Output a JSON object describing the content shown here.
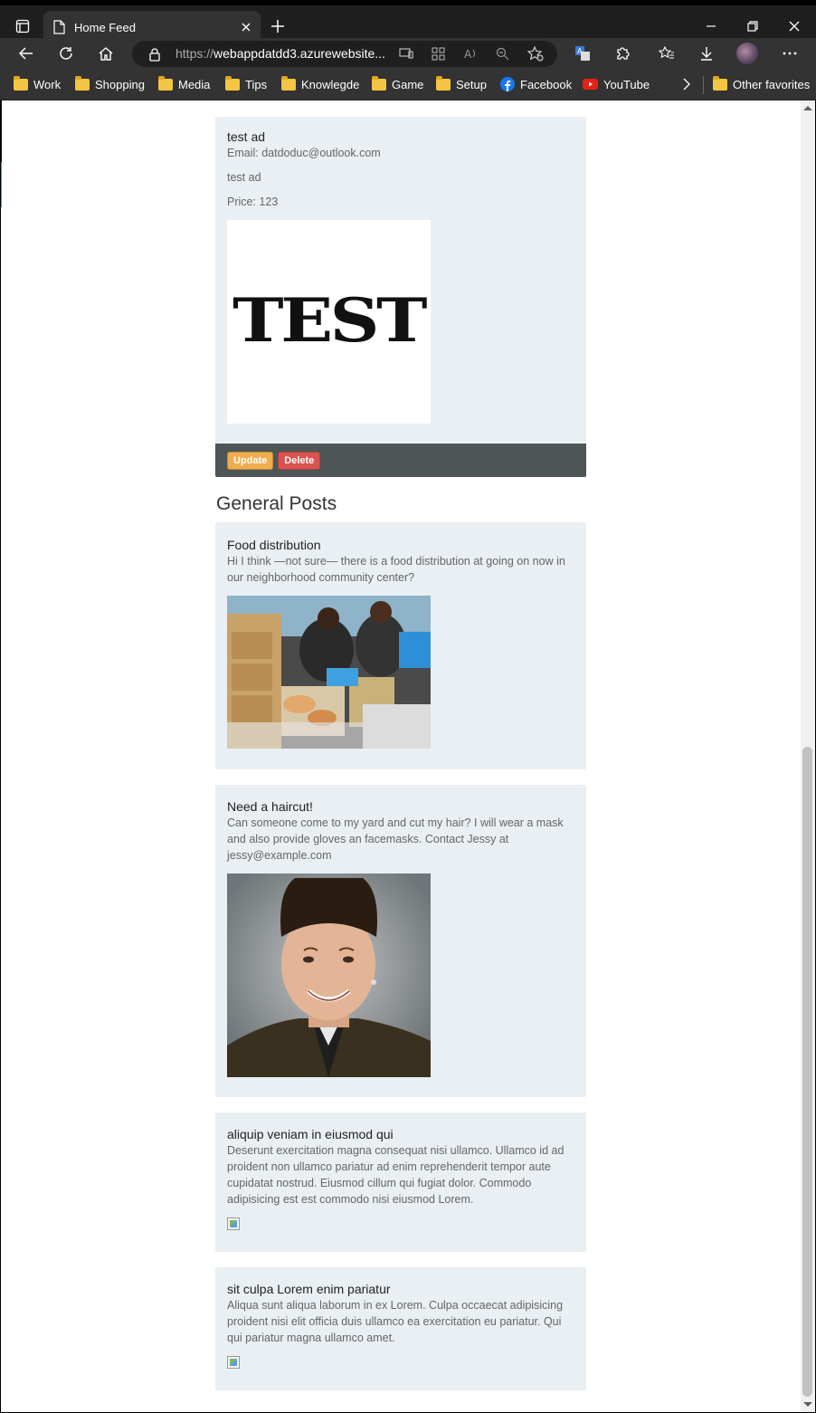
{
  "browser": {
    "tab_title": "Home Feed",
    "url_prefix": "https://",
    "url_host": "webappdatdd3.azurewebsite...",
    "bookmarks": [
      {
        "label": "Work",
        "icon": "folder-icon"
      },
      {
        "label": "Shopping",
        "icon": "folder-icon"
      },
      {
        "label": "Media",
        "icon": "folder-icon"
      },
      {
        "label": "Tips",
        "icon": "folder-icon"
      },
      {
        "label": "Knowlegde",
        "icon": "folder-icon"
      },
      {
        "label": "Game",
        "icon": "folder-icon"
      },
      {
        "label": "Setup",
        "icon": "folder-icon"
      },
      {
        "label": "Facebook",
        "icon": "facebook-icon"
      },
      {
        "label": "YouTube",
        "icon": "youtube-icon"
      }
    ],
    "other_favorites": "Other favorites"
  },
  "my_ad": {
    "title": "test ad",
    "email": "Email: datdoduc@outlook.com",
    "description": "test ad",
    "price": "Price: 123",
    "image_text": "TEST",
    "update_label": "Update",
    "delete_label": "Delete"
  },
  "general_posts": {
    "heading": "General Posts",
    "posts": [
      {
        "title": "Food distribution",
        "body": "Hi I think —not sure— there is a food distribution at going on now in our neighborhood community center?",
        "image": "food-distribution-photo"
      },
      {
        "title": "Need a haircut!",
        "body": "Can someone come to my yard and cut my hair? I will wear a mask and also provide gloves an facemasks. Contact Jessy at jessy@example.com",
        "image": "portrait-photo"
      },
      {
        "title": "aliquip veniam in eiusmod qui",
        "body": "Deserunt exercitation magna consequat nisi ullamco. Ullamco id ad proident non ullamco pariatur ad enim reprehenderit tempor aute cupidatat nostrud. Eiusmod cillum qui fugiat dolor. Commodo adipisicing est est commodo nisi eiusmod Lorem.",
        "image": "broken-image-icon"
      },
      {
        "title": "sit culpa Lorem enim pariatur",
        "body": "Aliqua sunt aliqua laborum in ex Lorem. Culpa occaecat adipisicing proident nisi elit officia duis ullamco ea exercitation eu pariatur. Qui qui pariatur magna ullamco amet.",
        "image": "broken-image-icon"
      }
    ]
  },
  "colors": {
    "card_bg": "#e9eff2",
    "actions_bar": "#4d5556",
    "update_button": "#f0ad4e",
    "delete_button": "#d9534f"
  }
}
